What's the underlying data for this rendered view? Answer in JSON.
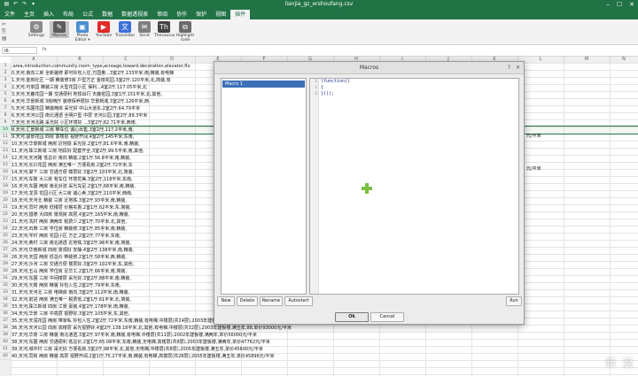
{
  "window": {
    "title": "lianjia_gz_ershoufang.csv",
    "controls": [
      "–",
      "☐",
      "✕"
    ]
  },
  "quick_access": [
    "▤",
    "↶",
    "↷",
    "▾"
  ],
  "menu_tabs": [
    "文件",
    "主页",
    "插入",
    "布局",
    "公式",
    "数据",
    "数据透视表",
    "审阅",
    "协作",
    "保护",
    "视图",
    "插件"
  ],
  "ribbon": {
    "buttons": [
      {
        "label": "Settings",
        "icon": "gear-icon",
        "glyph": "⚙",
        "color": "#8a8a8a"
      },
      {
        "label": "Macros",
        "icon": "macro-icon",
        "glyph": "✎",
        "color": "#5c5c5c"
      },
      {
        "label": "Photo Editor ▾",
        "icon": "photo-editor-icon",
        "glyph": "▣",
        "color": "#4a8fd0"
      },
      {
        "label": "YouTube",
        "icon": "youtube-icon",
        "glyph": "▶",
        "color": "#e02b27"
      },
      {
        "label": "Translator",
        "icon": "translator-icon",
        "glyph": "文",
        "color": "#3c6fd8"
      },
      {
        "label": "Send",
        "icon": "send-icon",
        "glyph": "✉",
        "color": "#7f7f7f"
      },
      {
        "label": "Thesaurus",
        "icon": "thesaurus-icon",
        "glyph": "Th",
        "color": "#444444"
      },
      {
        "label": "Highlight code",
        "icon": "highlight-code-icon",
        "glyph": "⧉",
        "color": "#6b6b6b"
      }
    ]
  },
  "formula_bar": {
    "cell_ref": "I6",
    "fx": "fx"
  },
  "columns": [
    "A",
    "B",
    "C",
    "D",
    "E",
    "F",
    "G",
    "H",
    "I",
    "J",
    "K",
    "L",
    "M",
    "N"
  ],
  "rows": [
    ",area,introduction,community,room_type,acreage,toward,decoration,elevator,flo",
    "0,天河,南向三房 全新装修 即可拎包入住,万国奥..,3室2厅,133平米,南,精装,有电梯",
    "1,天河,金田社区 一期 精装修3房 户型方正 金田花园,3室2厅,120平米,北,简装,有",
    "2,天河,可单园 精装三房 大型花园小区 保利..,4室2厅,117.05平米,北",
    "3,天河,天鹿花园一期 交通便利 地铁出行 天鹿花园,3室1厅,151平米,北,其他,",
    "4,天河,华景新城 3房两厅 装修保养很好 华景新城,3室2厅,126平米,西",
    "5,天河,东圃花园 精装两房 采光好 中山大道东,2室2厅,64.79平米",
    "6,天河,天河公园 南北通透 全明户型 中层 天河公园,3室2厅,89.3平米",
    "7,天河,天河北路 采光好 小区环境好 ..,3室2厅,62.71平米,西南,",
    "8,天河,汇景新城 三房 带车位 诚心出售,3室2厅,117.2平米,南,",
    "9,天河,骏景花园 四房 高楼层 视野开阔,4室2厅,145平米,东南,",
    "10,天河,华景新城 两房 近地铁 采光好,2室1厅,81.6平米,南,精装,",
    "11,天河,珠江新城 三房 地段好 配套齐全,3室2厅,99.5平米,南,其他,",
    "12,天河,天河路 低总价 南向 精装,2室1厅,56.8平米,南,精装,",
    "13,天河,长兴花园 两房 满五唯一 方便看房,2室2厅,72平米,东",
    "14,天河,棠下 三房 交通方便 楼层好,3室2厅,103平米,北,简装,",
    "15,天河,车陂 大三房 有车位 环境优美,3室2厅,118平米,东南,",
    "16,天河,东圃 两房 南北对流 采光充足,2室1厅,68平米,南,精装,",
    "17,天河,龙洞 花园小区 大三房 诚心卖,3室2厅,110平米,西南,",
    "18,天河,天河北 精装 三房 近地铁,3室2厅,93平米,南,精装,",
    "19,天河,员村 两房 低楼层 价格实惠,2室1厅,62平米,东,简装,",
    "20,天河,猎德 大四房 景观房 高层,4室2厅,165平米,南,精装,",
    "21,天河,冼村 两房 满两年 税费少,2室1厅,70平米,北,其他,",
    "22,天河,石牌 三房 学位房 精装修,3室1厅,85平米,南,精装,",
    "23,天河,岑村 两房 花园小区 方正,2室2厅,77平米,东南,",
    "24,天河,黄村 三房 南北通透 近地铁,3室2厅,96平米,南,简装,",
    "25,天河,华南新城 四房 景观好 安静,4室2厅,138平米,南,精装,",
    "26,天河,天园 两房 低总价 带装修,2室1厅,58平米,西,精装,",
    "27,天河,沙河 三房 交通方便 楼层好,3室2厅,102平米,东,其他,",
    "28,天河,五山 两房 学位房 近华工,2室1厅,66平米,南,简装,",
    "29,天河,东圃 三房 中间楼层 采光好,3室2厅,88平米,南,精装,",
    "30,天河,元岗 两房 精装 拎包入住,2室2厅,79平米,东南,",
    "31,天河,天河北 三房 电梯房 南向,3室2厅,112平米,南,精装,",
    "32,天河,前进 两房 满五唯一 税费低,2室1厅,61平米,北,简装,",
    "33,天河,珠江新城 四房 江景 豪装,4室2厅,178平米,南,精装,",
    "34,天河,华景 三房 中高层 视野好,3室2厅,105平米,东,其他,",
    "35,天河,天润花园 两房 带家私 拎包入住,2室2厅,72平米,东南,精装,有电梯,中楼层(共24层),2003年建板塔结合,,满五年,92,单价17950元/平米",
    "36,天河,天河公园 四房 高楼层 采光视野好,4室2厅,138.18平米,北,其他,有电梯,中楼层(共32层),2003年建板楼,满五年,88,单价93000元/平米",
    "37,天河,华景 三房 精装 南北通透,3室2厅,97平米,南,精装,有电梯,中楼层(共11层),2002年建板楼,满两年,单价56000元/平米",
    "38,天河,东圃 两房 交通便利 低总价,2室1厅,65.08平米,东南,精装,无电梯,高楼层(共8层),2003年建板楼,满两年,单价47762元/平米",
    "39,天河,城中村 三房 采光好 方便看房,3室2厅,98平米,北,其他,无电梯,中楼层(共8层),2005年建板楼,满五年,单价45600元/平米",
    "40,天河,同和 两房 精装 高层 视野开阔,2室1厅,75.27平米,南,精装,有电梯,高楼层(共28层),2005年建板楼,满五年,单价45896元/平米"
  ],
  "overflow_notes": [
    "元/平米",
    "元/平米"
  ],
  "dialog": {
    "title": "Macros",
    "controls": [
      "?",
      "✕"
    ],
    "list": [
      "Macro 1"
    ],
    "line_numbers": [
      "1",
      "2",
      "3"
    ],
    "code": [
      "(function()",
      "{",
      "})();"
    ],
    "buttons": {
      "new": "New",
      "delete": "Delete",
      "rename": "Rename",
      "autostart": "Autostart",
      "run": "Run",
      "ok": "Ok",
      "cancel": "Cancel"
    }
  },
  "watermark": "新 浪"
}
